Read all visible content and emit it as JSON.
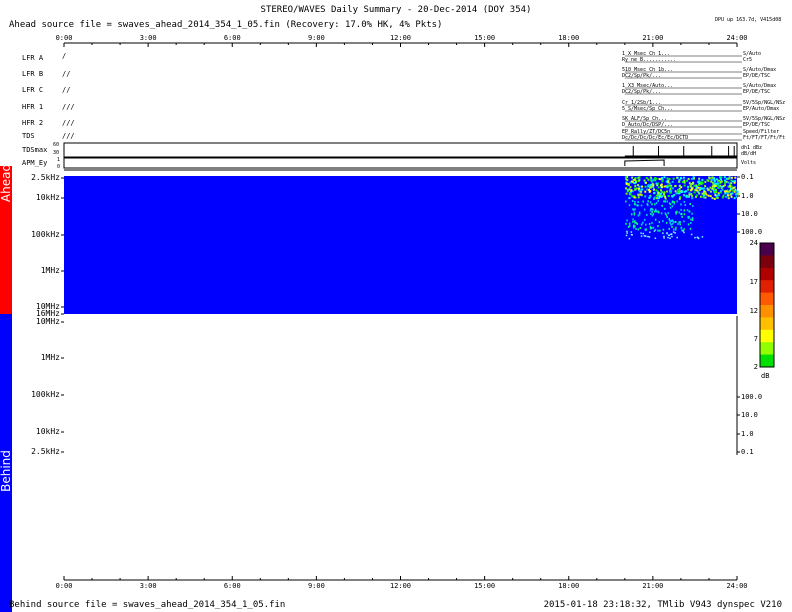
{
  "title": "STEREO/WAVES Daily Summary - 20-Dec-2014 (DOY 354)",
  "ahead_source": "Ahead source file = swaves_ahead_2014_354_1_05.fin (Recovery: 17.0% HK,  4% Pkts)",
  "behind_source": "Behind source file = swaves_ahead_2014_354_1_05.fin",
  "footer_right": "2015-01-18 23:18:32, TMlib V943 dynspec V210",
  "dpu_note": "DPU up 163.7d, V415d08",
  "side_labels": {
    "ahead": "Ahead",
    "behind": "Behind"
  },
  "colors": {
    "ahead": "#ff0000",
    "behind": "#0000ff",
    "background": "#0000ff"
  },
  "time_ticks": [
    "0:00",
    "3:00",
    "6:00",
    "9:00",
    "12:00",
    "15:00",
    "18:00",
    "21:00",
    "24:00"
  ],
  "rows": [
    {
      "label": "LFR A",
      "marks": "/",
      "right1": "1 X Msec Ch 1...",
      "right2": "Ry ne B...........",
      "right3": "S/Auto",
      "right4": "Cr5"
    },
    {
      "label": "LFR B",
      "marks": "//",
      "right1": "510 Msec Ch 1b...",
      "right2": "DC2/Sp/Pk/...",
      "right3": "S/Auto/Dmax",
      "right4": "EP/DE/TSC"
    },
    {
      "label": "LFR C",
      "marks": "//",
      "right1": "1 X3 Msec/Auto...",
      "right2": "DC2/Sp/Pk/...",
      "right3": "S/Auto/Dmax",
      "right4": "EP/DE/TSC"
    },
    {
      "label": "HFR 1",
      "marks": "///",
      "right1": "Cr 1/2Sb/1...",
      "right2": "5 S/Msec/Sp Ch...",
      "right3": "5V/5Sp/NGL/NSz",
      "right4": "EP/Auto/Dmax"
    },
    {
      "label": "HFR 2",
      "marks": "///",
      "right1": "SK ALF/Sp Ch...",
      "right2": "D Auto/Dc/DSP/...",
      "right3": "5V/5Sp/NGL/NSz",
      "right4": "EP/DE/TSC"
    },
    {
      "label": "TDS",
      "marks": "///",
      "right1": "EP Rally/ZT/DC5n",
      "right2": "Dc/Dc/Dc/Dc/Ec/Ec/DCTD",
      "right3": "Speed/Filter",
      "right4": "Ft/FT/FT/Ft/Ft"
    }
  ],
  "tdsmax": {
    "label": "TDSmax",
    "levels": [
      "60",
      "30",
      "1"
    ],
    "right1": "dh1 dBz",
    "right2": "dB/dH"
  },
  "apm": {
    "label": "APM_Ey",
    "levels": [
      "1",
      "0"
    ],
    "right1": "Volts"
  },
  "freq_ahead": [
    "2.5kHz",
    "10kHz",
    "100kHz",
    "1MHz",
    "10MHz",
    "16MHz"
  ],
  "freq_behind": [
    "10MHz",
    "1MHz",
    "100kHz",
    "10kHz",
    "2.5kHz"
  ],
  "right_axis_ahead": [
    "0.1",
    "1.0",
    "10.0",
    "100.0"
  ],
  "right_axis_behind": [
    "100.0",
    "10.0",
    "1.0",
    "0.1"
  ],
  "colorbar": {
    "ticks": [
      "24",
      "17",
      "12",
      "7",
      "2"
    ],
    "unit": "dB",
    "min": 2,
    "max": 24
  },
  "chart_data": {
    "type": "heatmap",
    "title": "STEREO/WAVES Daily Summary - 20-Dec-2014 (DOY 354)",
    "xlabel": "",
    "ylabel": "",
    "x_range_hours": [
      0,
      24
    ],
    "y_axis_ahead": [
      "2.5kHz",
      "10kHz",
      "100kHz",
      "1MHz",
      "10MHz",
      "16MHz"
    ],
    "y_axis_behind": [
      "10MHz",
      "1MHz",
      "100kHz",
      "10kHz",
      "2.5kHz"
    ],
    "data_window_hours": [
      20.0,
      24.0
    ],
    "intensity_range_db": [
      2,
      24
    ],
    "behind_panel": "no data"
  }
}
